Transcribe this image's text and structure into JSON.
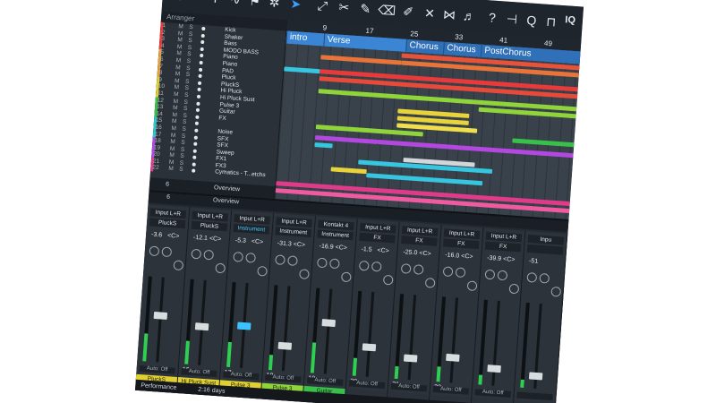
{
  "toolbar": {
    "iq_label": "IQ"
  },
  "arranger": {
    "panel_label": "Arranger"
  },
  "tracks": [
    {
      "num": "1",
      "name": "Kick",
      "color": "#e83a3a"
    },
    {
      "num": "2",
      "name": "Shaker",
      "color": "#e83a3a"
    },
    {
      "num": "3",
      "name": "Bass",
      "color": "#e83a3a"
    },
    {
      "num": "4",
      "name": "MODO BASS",
      "color": "#e83a3a"
    },
    {
      "num": "5",
      "name": "Piano",
      "color": "#e8a13a"
    },
    {
      "num": "6",
      "name": "Piano",
      "color": "#e8a13a"
    },
    {
      "num": "7",
      "name": "PAD",
      "color": "#e8a13a"
    },
    {
      "num": "8",
      "name": "Pluck",
      "color": "#e8a13a"
    },
    {
      "num": "9",
      "name": "PluckS",
      "color": "#e0d030"
    },
    {
      "num": "10",
      "name": "Hi Pluck",
      "color": "#e0d030"
    },
    {
      "num": "11",
      "name": "Hi Pluck Sust",
      "color": "#e0d030"
    },
    {
      "num": "12",
      "name": "Pulse 3",
      "color": "#39c04a"
    },
    {
      "num": "13",
      "name": "Guitar",
      "color": "#39c04a"
    },
    {
      "num": "14",
      "name": "FX",
      "color": "#39c04a"
    },
    {
      "num": "15",
      "name": "",
      "color": "#2ec7d0"
    },
    {
      "num": "16",
      "name": "Noise",
      "color": "#2ec7d0"
    },
    {
      "num": "17",
      "name": "SFX",
      "color": "#2ec7d0"
    },
    {
      "num": "18",
      "name": "SFX",
      "color": "#b348e0"
    },
    {
      "num": "19",
      "name": "Sweep",
      "color": "#b348e0"
    },
    {
      "num": "20",
      "name": "FX1",
      "color": "#b348e0"
    },
    {
      "num": "21",
      "name": "FX3",
      "color": "#e03a8a"
    },
    {
      "num": "22",
      "name": "Cymatics - T...etchs",
      "color": "#e03a8a"
    }
  ],
  "track_footer": {
    "left": "6",
    "right": "Overview"
  },
  "ruler": [
    "9",
    "17",
    "25",
    "33",
    "41",
    "49"
  ],
  "sections": [
    {
      "name": "intro"
    },
    {
      "name": "Verse"
    },
    {
      "name": "Chorus"
    },
    {
      "name": "Chorus"
    },
    {
      "name": "PostChorus"
    }
  ],
  "mixer": {
    "strips": [
      {
        "input": "Input L+R",
        "inst": "PluckS",
        "value": "-3.6",
        "pan": "<C>",
        "num": "",
        "label": "PluckS",
        "label_color": "#e0d030",
        "cap": "white",
        "level": 0.55,
        "auto": "Auto: Off"
      },
      {
        "input": "Input L+R",
        "inst": "PluckS",
        "value": "-12.1",
        "pan": "<C>",
        "num": "16",
        "label": "Hi Pluck Sust",
        "label_color": "#e0d030",
        "cap": "white",
        "level": 0.45,
        "auto": "Auto: Off"
      },
      {
        "input": "Input L+R",
        "inst": "Instrument",
        "value": "-5.3",
        "pan": "<C>",
        "num": "17",
        "label": "Pulse 3",
        "label_color": "#e0d030",
        "cap": "blue",
        "level": 0.5,
        "auto": "Auto: Off",
        "hi": true
      },
      {
        "input": "Input L+R",
        "inst": "Instrument",
        "value": "-31.3",
        "pan": "<C>",
        "num": "18",
        "label": "Pulse 3",
        "label_color": "#8fd43a",
        "cap": "white",
        "level": 0.3,
        "auto": "Auto: Off"
      },
      {
        "input": "Kontakt 4",
        "inst": "Instrument",
        "value": "-16.9",
        "pan": "<C>",
        "num": "19",
        "label": "Guitar",
        "label_color": "#39c04a",
        "cap": "white",
        "level": 0.6,
        "auto": "Auto: Off"
      },
      {
        "input": "Input L+R",
        "inst": "FX",
        "value": "-1.5",
        "pan": "<C>",
        "num": "20",
        "label": "",
        "label_color": "#2b3138",
        "cap": "white",
        "level": 0.35,
        "auto": "Auto: Off"
      },
      {
        "input": "Input L+R",
        "inst": "FX",
        "value": "-25.0",
        "pan": "<C>",
        "num": "21",
        "label": "",
        "label_color": "#2b3138",
        "cap": "white",
        "level": 0.25,
        "auto": "Auto: Off"
      },
      {
        "input": "Input L+R",
        "inst": "FX",
        "value": "-16.0",
        "pan": "<C>",
        "num": "22",
        "label": "",
        "label_color": "#2b3138",
        "cap": "white",
        "level": 0.3,
        "auto": "Auto: Off"
      },
      {
        "input": "Input L+R",
        "inst": "FX",
        "value": "-39.9",
        "pan": "<C>",
        "num": "",
        "label": "",
        "label_color": "#2b3138",
        "cap": "white",
        "level": 0.2,
        "auto": "Auto: Off"
      },
      {
        "input": "Inpu",
        "inst": "",
        "value": "-51",
        "pan": "",
        "num": "",
        "label": "",
        "label_color": "#2b3138",
        "cap": "white",
        "level": 0.15,
        "auto": ""
      }
    ]
  },
  "perf": {
    "label": "Performance",
    "time": "2:16 days"
  }
}
